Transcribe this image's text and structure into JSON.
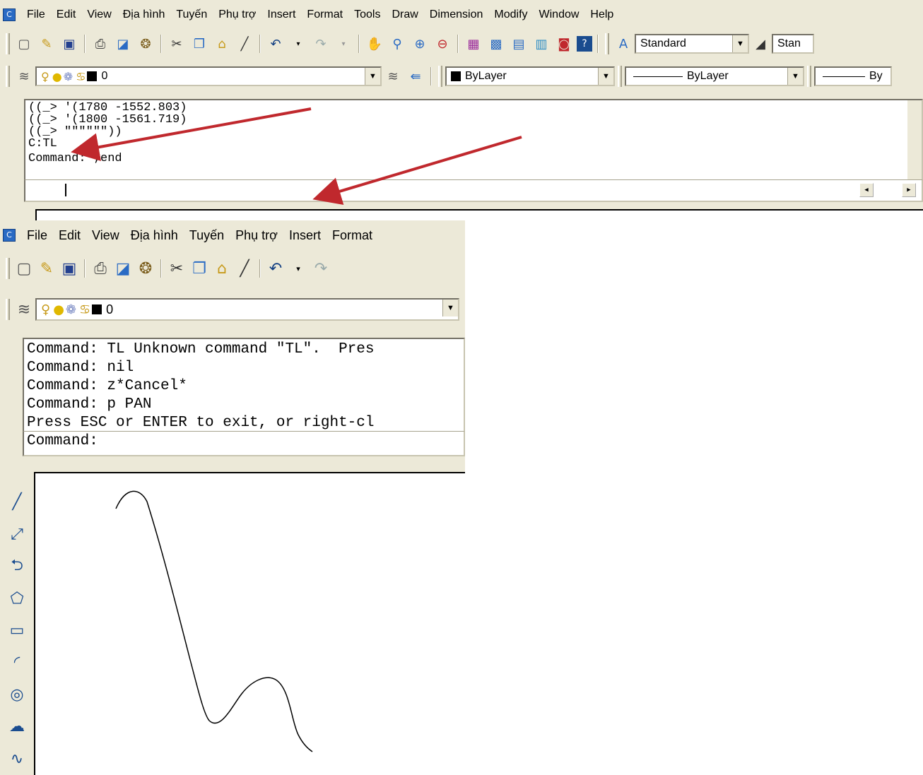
{
  "menu": {
    "app_icon": "C",
    "items": [
      "File",
      "Edit",
      "View",
      "Địa hình",
      "Tuyến",
      "Phụ trợ",
      "Insert",
      "Format",
      "Tools",
      "Draw",
      "Dimension",
      "Modify",
      "Window",
      "Help"
    ],
    "items_bottom": [
      "File",
      "Edit",
      "View",
      "Địa hình",
      "Tuyến",
      "Phụ trợ",
      "Insert",
      "Format"
    ]
  },
  "toolbar": {
    "text_style": "Standard",
    "dim_style": "Stan",
    "layer_name": "0",
    "color": "ByLayer",
    "linetype": "ByLayer",
    "lineweight": "By"
  },
  "top_command": {
    "lines": [
      "((_> '(1780 -1552.803)",
      "((_> '(1800 -1561.719)",
      "((_> \"\"\"\"\"\"))",
      "C:TL",
      "Command: ;end"
    ],
    "current_input": ""
  },
  "bottom_command": {
    "lines": [
      "Command: TL Unknown command \"TL\".  Pres",
      "Command: nil",
      "Command: z*Cancel*",
      "Command: p PAN",
      "Press ESC or ENTER to exit, or right-cl"
    ],
    "prompt": "Command:"
  },
  "icons": {
    "toolbar1": [
      "new-icon",
      "open-icon",
      "save-icon",
      "print-icon",
      "plot-preview-icon",
      "publish-icon",
      "cut-icon",
      "copy-icon",
      "paste-icon",
      "match-properties-icon",
      "undo-icon",
      "redo-icon",
      "pan-icon",
      "zoom-realtime-icon",
      "zoom-window-icon",
      "zoom-previous-icon",
      "properties-icon",
      "design-center-icon",
      "tool-palettes-icon",
      "sheet-set-icon",
      "markup-icon",
      "help-icon"
    ],
    "draw_tools": [
      "line-icon",
      "construction-line-icon",
      "polyline-icon",
      "polygon-icon",
      "rectangle-icon",
      "arc-icon",
      "circle-icon",
      "revision-cloud-icon",
      "spline-icon"
    ]
  },
  "colors": {
    "panel": "#ece9d8",
    "annotation_arrow": "#c0282d"
  }
}
